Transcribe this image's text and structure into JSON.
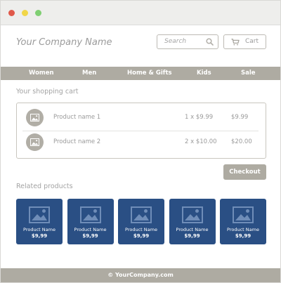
{
  "window": {
    "controls": {
      "close_color": "#e0594a",
      "minimize_color": "#f1d648",
      "zoom_color": "#7fcf72"
    }
  },
  "header": {
    "brand": "Your Company Name",
    "search": {
      "placeholder": "Search",
      "icon": "search-icon"
    },
    "cart": {
      "label": "Cart",
      "icon": "cart-icon"
    }
  },
  "nav": {
    "items": [
      {
        "label": "Women"
      },
      {
        "label": "Men"
      },
      {
        "label": "Home & Gifts"
      },
      {
        "label": "Kids"
      },
      {
        "label": "Sale"
      }
    ]
  },
  "cart_section": {
    "title": "Your shopping cart",
    "items": [
      {
        "name": "Product name 1",
        "quantity_price": "1 x $9.99",
        "total": "$9.99",
        "icon": "image-icon"
      },
      {
        "name": "Product name 2",
        "quantity_price": "2 x $10.00",
        "total": "$20.00",
        "icon": "image-icon"
      }
    ],
    "checkout_label": "Checkout"
  },
  "related": {
    "title": "Related products",
    "items": [
      {
        "name": "Product Name",
        "price": "$9,99",
        "icon": "image-icon"
      },
      {
        "name": "Product Name",
        "price": "$9,99",
        "icon": "image-icon"
      },
      {
        "name": "Product Name",
        "price": "$9,99",
        "icon": "image-icon"
      },
      {
        "name": "Product Name",
        "price": "$9,99",
        "icon": "image-icon"
      },
      {
        "name": "Product Name",
        "price": "$9,99",
        "icon": "image-icon"
      }
    ]
  },
  "footer": {
    "text": "© YourCompany.com"
  },
  "colors": {
    "accent": "#aeaba2",
    "product_tile": "#2a4f84",
    "text_muted": "#9a9a9a"
  }
}
